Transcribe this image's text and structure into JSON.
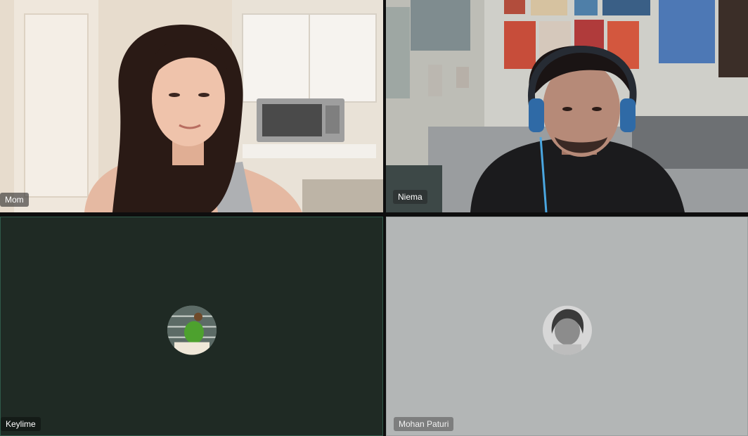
{
  "participants": [
    {
      "name": "Mom",
      "video_on": true
    },
    {
      "name": "Niema",
      "video_on": true
    },
    {
      "name": "Keylime",
      "video_on": false,
      "tile_color": "#1f2a24"
    },
    {
      "name": "Mohan Paturi",
      "video_on": false,
      "tile_color": "#b3b6b6"
    }
  ]
}
